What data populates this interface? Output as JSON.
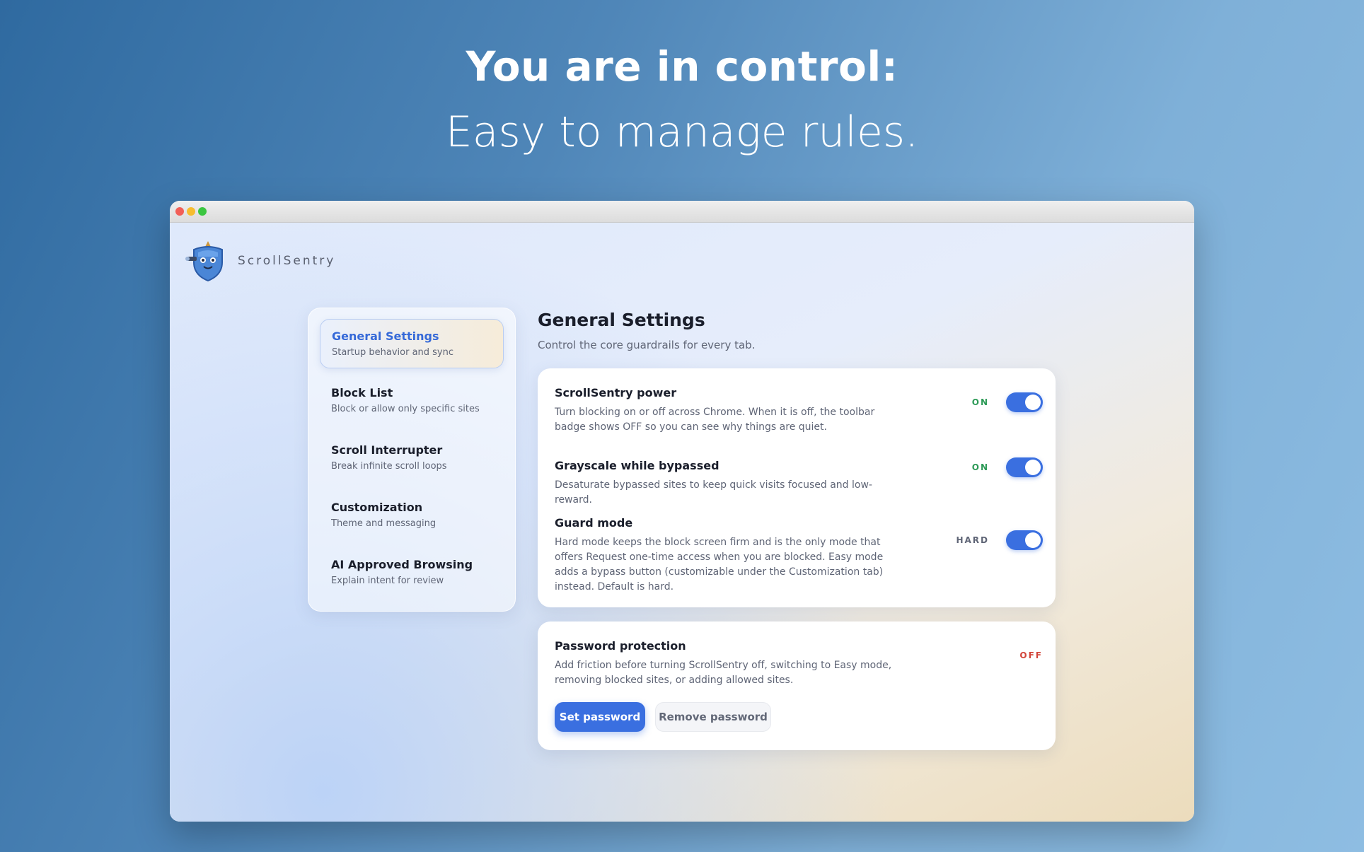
{
  "hero": {
    "title": "You are in control:",
    "subtitle": "Easy to manage rules."
  },
  "app": {
    "name": "ScrollSentry"
  },
  "sidebar": {
    "items": [
      {
        "title": "General Settings",
        "subtitle": "Startup behavior and sync",
        "active": true
      },
      {
        "title": "Block List",
        "subtitle": "Block or allow only specific sites",
        "active": false
      },
      {
        "title": "Scroll Interrupter",
        "subtitle": "Break infinite scroll loops",
        "active": false
      },
      {
        "title": "Customization",
        "subtitle": "Theme and messaging",
        "active": false
      },
      {
        "title": "AI Approved Browsing",
        "subtitle": "Explain intent for review",
        "active": false
      }
    ]
  },
  "main": {
    "title": "General Settings",
    "subtitle": "Control the core guardrails for every tab.",
    "settings": [
      {
        "title": "ScrollSentry power",
        "description": "Turn blocking on or off across Chrome. When it is off, the toolbar badge shows OFF so you can see why things are quiet.",
        "state": "ON",
        "enabled": true
      },
      {
        "title": "Grayscale while bypassed",
        "description": "Desaturate bypassed sites to keep quick visits focused and low-reward.",
        "state": "ON",
        "enabled": true
      },
      {
        "title": "Guard mode",
        "description": "Hard mode keeps the block screen firm and is the only mode that offers Request one-time access when you are blocked. Easy mode adds a bypass button (customizable under the Customization tab) instead. Default is hard.",
        "state": "HARD",
        "enabled": true
      }
    ],
    "password": {
      "title": "Password protection",
      "description": "Add friction before turning ScrollSentry off, switching to Easy mode, removing blocked sites, or adding allowed sites.",
      "state": "OFF",
      "set_label": "Set password",
      "remove_label": "Remove password"
    }
  },
  "colors": {
    "accent": "#3a6fe0",
    "on": "#2d9a57",
    "off": "#d2453a"
  }
}
